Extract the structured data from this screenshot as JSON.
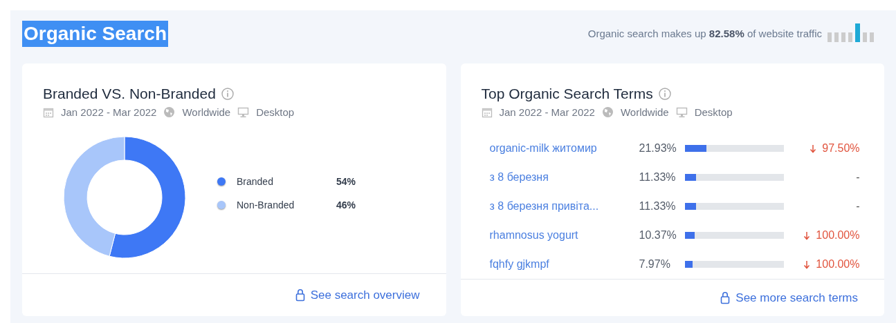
{
  "header": {
    "title": "Organic Search",
    "highlighted": true,
    "summary": "Organic search makes up **82.58%** of website traffic"
  },
  "branded_card": {
    "title": "Branded VS. Non-Branded",
    "date_range": "Jan 2022 - Mar 2022",
    "region": "Worldwide",
    "device": "Desktop",
    "chart_data": {
      "type": "donut",
      "categories": [
        "Branded",
        "Non-Branded"
      ],
      "values": [
        54,
        46
      ]
    },
    "legend": [
      {
        "value": "54%",
        "color": "#3e78f5"
      },
      {
        "value": "46%",
        "color": "#a8c6fa"
      }
    ],
    "footer_link": "See search overview"
  },
  "terms_card": {
    "title": "Top Organic Search Terms",
    "date_range": "Jan 2022 - Mar 2022",
    "region": "Worldwide",
    "device": "Desktop",
    "rows": [
      {
        "term": "organic-milk житомир",
        "share": "21.93%",
        "level": 0.2193,
        "kind": "down",
        "change": "97.50%"
      },
      {
        "term": "з 8 березня",
        "share": "11.33%",
        "level": 0.1133,
        "kind": "flat",
        "change": "-"
      },
      {
        "term": "з 8 березня привіта...",
        "share": "11.33%",
        "level": 0.1133,
        "kind": "flat",
        "change": "-"
      },
      {
        "term": "rhamnosus yogurt",
        "share": "10.37%",
        "level": 0.1037,
        "kind": "down",
        "change": "100.00%"
      },
      {
        "term": "fqhfy gjkmpf",
        "share": "7.97%",
        "level": 0.0797,
        "kind": "down",
        "change": "100.00%"
      }
    ],
    "footer_link": "See more search terms"
  }
}
